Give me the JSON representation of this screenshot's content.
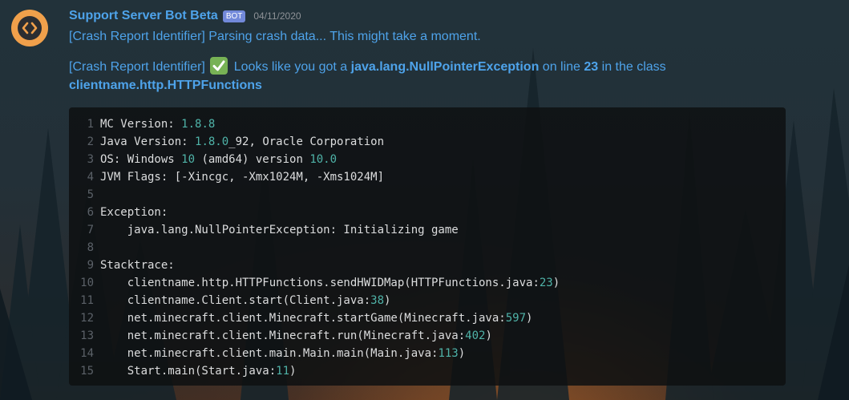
{
  "message": {
    "author": "Support Server Bot Beta",
    "bot_tag": "BOT",
    "timestamp": "04/11/2020",
    "line1": "[Crash Report Identifier] Parsing crash data... This might take a moment.",
    "line2_prefix": "[Crash Report Identifier]",
    "line2_text_a": " Looks like you got a ",
    "line2_exception": "java.lang.NullPointerException",
    "line2_text_b": " on line ",
    "line2_line_number": "23",
    "line2_text_c": " in the class",
    "line3_class": "clientname.http.HTTPFunctions"
  },
  "code": [
    {
      "n": "1",
      "t": "MC Version: ",
      "v": "1.8.8",
      "r": ""
    },
    {
      "n": "2",
      "t": "Java Version: ",
      "v": "1.8.0",
      "r": "_92, Oracle Corporation"
    },
    {
      "n": "3",
      "t": "OS: Windows ",
      "v": "10",
      "r": " (amd64) version ",
      "v2": "10.0"
    },
    {
      "n": "4",
      "t": "JVM Flags: [-Xincgc, -Xmx1024M, -Xms1024M]",
      "v": "",
      "r": ""
    },
    {
      "n": "5",
      "t": "",
      "v": "",
      "r": ""
    },
    {
      "n": "6",
      "t": "Exception:",
      "v": "",
      "r": ""
    },
    {
      "n": "7",
      "t": "    java.lang.NullPointerException: Initializing game",
      "v": "",
      "r": ""
    },
    {
      "n": "8",
      "t": "",
      "v": "",
      "r": ""
    },
    {
      "n": "9",
      "t": "Stacktrace:",
      "v": "",
      "r": ""
    },
    {
      "n": "10",
      "t": "    clientname.http.HTTPFunctions.sendHWIDMap(HTTPFunctions.java:",
      "v": "23",
      "r": ")"
    },
    {
      "n": "11",
      "t": "    clientname.Client.start(Client.java:",
      "v": "38",
      "r": ")"
    },
    {
      "n": "12",
      "t": "    net.minecraft.client.Minecraft.startGame(Minecraft.java:",
      "v": "597",
      "r": ")"
    },
    {
      "n": "13",
      "t": "    net.minecraft.client.Minecraft.run(Minecraft.java:",
      "v": "402",
      "r": ")"
    },
    {
      "n": "14",
      "t": "    net.minecraft.client.main.Main.main(Main.java:",
      "v": "113",
      "r": ")"
    },
    {
      "n": "15",
      "t": "    Start.main(Start.java:",
      "v": "11",
      "r": ")"
    }
  ],
  "colors": {
    "link_blue": "#4ea3ea",
    "bot_tag": "#7289da",
    "number_teal": "#4fb3a8",
    "avatar_orange": "#f0a04b",
    "check_green": "#77b255"
  },
  "icons": {
    "avatar": "code-brackets-icon",
    "check": "white-check-mark-icon"
  }
}
